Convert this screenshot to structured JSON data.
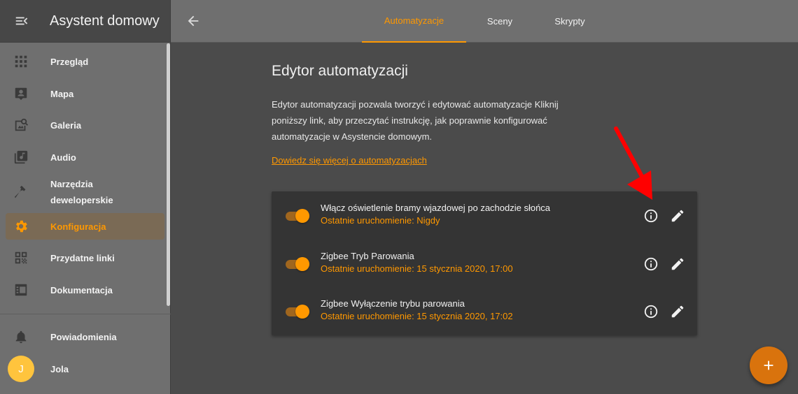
{
  "app": {
    "title": "Asystent domowy"
  },
  "sidebar": {
    "items": [
      {
        "label": "Przegląd",
        "icon": "grid-icon"
      },
      {
        "label": "Mapa",
        "icon": "map-account-icon"
      },
      {
        "label": "Galeria",
        "icon": "image-search-icon"
      },
      {
        "label": "Audio",
        "icon": "music-box-icon"
      },
      {
        "label": "Narzędzia deweloperskie",
        "icon": "hammer-icon"
      },
      {
        "label": "Konfiguracja",
        "icon": "gear-icon",
        "active": true
      },
      {
        "label": "Przydatne linki",
        "icon": "qr-code-icon"
      },
      {
        "label": "Dokumentacja",
        "icon": "newspaper-icon"
      }
    ],
    "notifications_label": "Powiadomienia",
    "user": {
      "name": "Jola",
      "initial": "J"
    }
  },
  "tabs": [
    {
      "label": "Automatyzacje",
      "active": true
    },
    {
      "label": "Sceny"
    },
    {
      "label": "Skrypty"
    }
  ],
  "main": {
    "title": "Edytor automatyzacji",
    "intro": "Edytor automatyzacji pozwala tworzyć i edytować automatyzacje Kliknij poniższy link, aby przeczytać instrukcję, jak poprawnie konfigurować automatyzacje w Asystencie domowym.",
    "learn_more": "Dowiedz się więcej o automatyzacjach",
    "automations": [
      {
        "name": "Włącz oświetlenie bramy wjazdowej po zachodzie słońca",
        "last_run": "Ostatnie uruchomienie: Nigdy",
        "enabled": true
      },
      {
        "name": "Zigbee Tryb Parowania",
        "last_run": "Ostatnie uruchomienie: 15 stycznia 2020, 17:00",
        "enabled": true
      },
      {
        "name": "Zigbee Wyłączenie trybu parowania",
        "last_run": "Ostatnie uruchomienie: 15 stycznia 2020, 17:02",
        "enabled": true
      }
    ]
  },
  "colors": {
    "accent": "#ff9800",
    "annotation": "#ff0000",
    "fab": "#d9730d"
  }
}
